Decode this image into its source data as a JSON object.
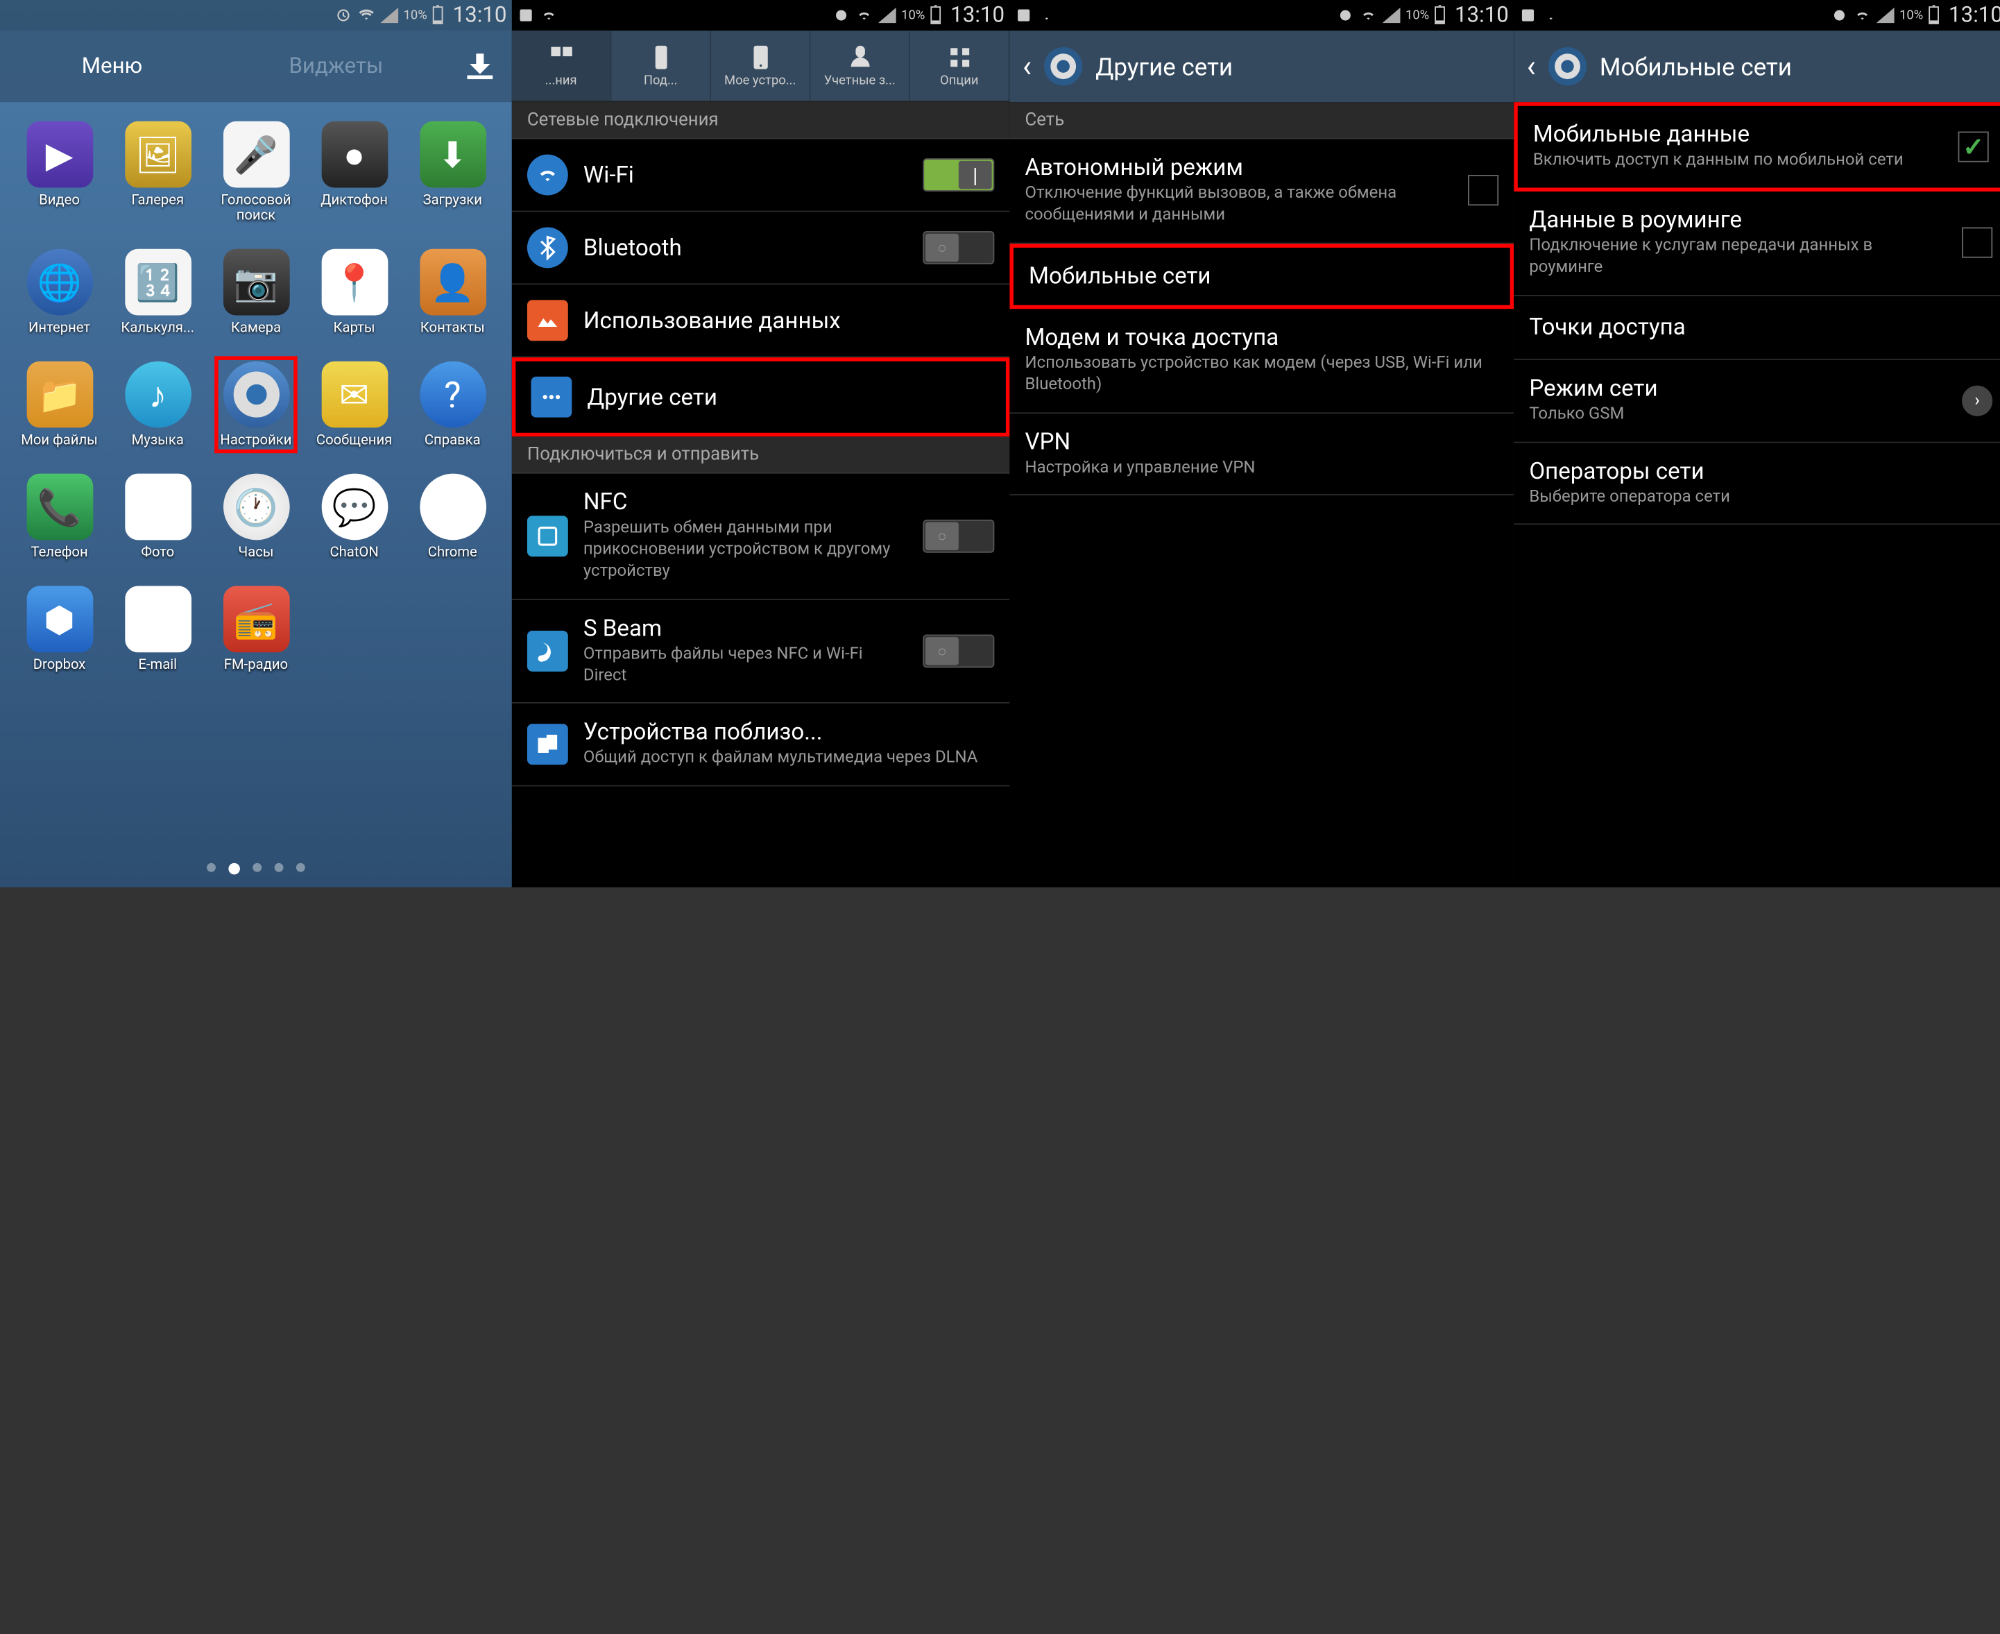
{
  "status": {
    "battery_pct": "10%",
    "time": "13:10"
  },
  "s1": {
    "tabs": {
      "menu": "Меню",
      "widgets": "Виджеты"
    },
    "apps": [
      {
        "label": "Видео"
      },
      {
        "label": "Галерея"
      },
      {
        "label": "Голосовой\nпоиск"
      },
      {
        "label": "Диктофон"
      },
      {
        "label": "Загрузки"
      },
      {
        "label": "Интернет"
      },
      {
        "label": "Калькуля..."
      },
      {
        "label": "Камера"
      },
      {
        "label": "Карты"
      },
      {
        "label": "Контакты"
      },
      {
        "label": "Мои файлы"
      },
      {
        "label": "Музыка"
      },
      {
        "label": "Настройки"
      },
      {
        "label": "Сообщения"
      },
      {
        "label": "Справка"
      },
      {
        "label": "Телефон"
      },
      {
        "label": "Фото"
      },
      {
        "label": "Часы"
      },
      {
        "label": "ChatON"
      },
      {
        "label": "Chrome"
      },
      {
        "label": "Dropbox"
      },
      {
        "label": "E-mail"
      },
      {
        "label": "FM-радио"
      }
    ]
  },
  "s2": {
    "tabs": [
      "...ния",
      "Под...",
      "Мое устро...",
      "Учетные з...",
      "Опции"
    ],
    "sec1": "Сетевые подключения",
    "wifi": "Wi-Fi",
    "bluetooth": "Bluetooth",
    "data_usage": "Использование данных",
    "more_networks": "Другие сети",
    "sec2": "Подключиться и отправить",
    "nfc": {
      "title": "NFC",
      "sub": "Разрешить обмен данными при прикосновении устройством к другому устройству"
    },
    "sbeam": {
      "title": "S Beam",
      "sub": "Отправить файлы через NFC и Wi-Fi Direct"
    },
    "nearby": {
      "title": "Устройства поблизо...",
      "sub": "Общий доступ к файлам мультимедиа через DLNA"
    }
  },
  "s3": {
    "title": "Другие сети",
    "sec1": "Сеть",
    "airplane": {
      "title": "Автономный режим",
      "sub": "Отключение функций вызовов, а также обмена сообщениями и данными"
    },
    "mobile_networks": "Мобильные сети",
    "tethering": {
      "title": "Модем и точка доступа",
      "sub": "Использовать устройство как модем (через USB, Wi-Fi или Bluetooth)"
    },
    "vpn": {
      "title": "VPN",
      "sub": "Настройка и управление VPN"
    }
  },
  "s4": {
    "title": "Мобильные сети",
    "mobile_data": {
      "title": "Мобильные данные",
      "sub": "Включить доступ к данным по мобильной сети"
    },
    "roaming": {
      "title": "Данные в роуминге",
      "sub": "Подключение к услугам передачи данных в роуминге"
    },
    "apn": "Точки доступа",
    "mode": {
      "title": "Режим сети",
      "sub": "Только GSM"
    },
    "operators": {
      "title": "Операторы сети",
      "sub": "Выберите оператора сети"
    }
  }
}
